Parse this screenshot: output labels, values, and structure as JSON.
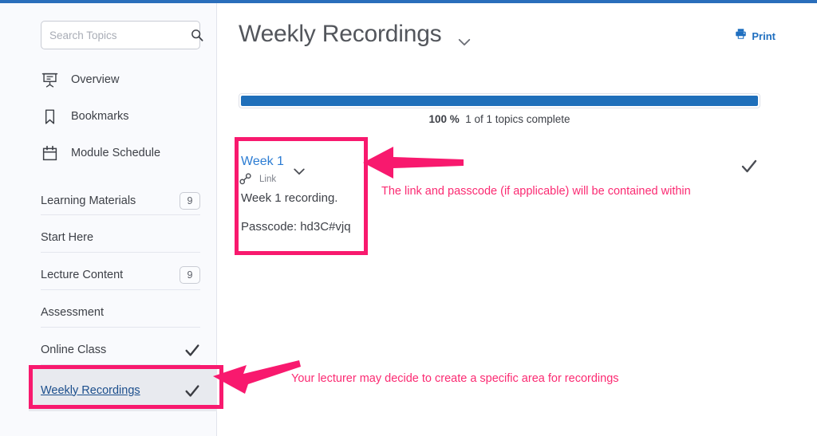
{
  "colors": {
    "top_strip": "#2a6ebb",
    "sidebar_bg": "#f9fafd",
    "accent_blue": "#1f6fba",
    "link_blue": "#2b7cd3",
    "annotation_pink": "#f8196e",
    "active_row_bg": "#e8eaef",
    "active_row_text": "#1b4e8c"
  },
  "sidebar": {
    "search": {
      "placeholder": "Search Topics",
      "value": "",
      "icon": "search-icon"
    },
    "icon_items": [
      {
        "label": "Overview",
        "icon": "presentation-screen-icon"
      },
      {
        "label": "Bookmarks",
        "icon": "bookmark-icon"
      },
      {
        "label": "Module Schedule",
        "icon": "calendar-icon"
      }
    ],
    "rows": [
      {
        "label": "Learning Materials",
        "badge": "9",
        "tick": false,
        "active": false
      },
      {
        "label": "Start Here",
        "badge": "",
        "tick": false,
        "active": false
      },
      {
        "label": "Lecture Content",
        "badge": "9",
        "tick": false,
        "active": false
      },
      {
        "label": "Assessment",
        "badge": "",
        "tick": false,
        "active": false
      },
      {
        "label": "Online Class",
        "badge": "",
        "tick": true,
        "active": false
      },
      {
        "label": "Weekly Recordings",
        "badge": "",
        "tick": true,
        "active": true
      }
    ]
  },
  "main": {
    "title": "Weekly Recordings",
    "title_caret_icon": "chevron-down-icon",
    "print": {
      "label": "Print",
      "icon": "printer-icon"
    },
    "progress": {
      "percent": 100,
      "percent_label": "100 %",
      "caption": "1 of 1 topics complete",
      "fill_width": "100%"
    },
    "topic": {
      "title": "Week 1",
      "caret_icon": "chevron-down-icon",
      "type_icon": "link-chain-icon",
      "type_label": "Link",
      "description": "Week 1 recording.",
      "passcode_line": "Passcode: hd3C#vjq",
      "completion_icon": "checkmark-icon"
    }
  },
  "annotations": [
    {
      "id": "topic-callout",
      "text": "The link and passcode (if applicable) will be contained within",
      "arrow": "arrow-left-icon"
    },
    {
      "id": "nav-callout",
      "text": "Your lecturer may decide to create a specific area for recordings",
      "arrow": "arrow-up-left-icon"
    }
  ]
}
